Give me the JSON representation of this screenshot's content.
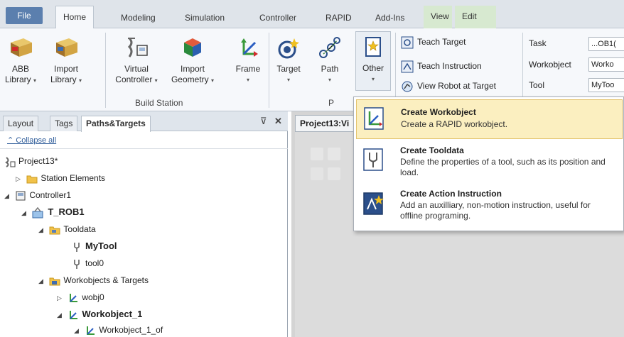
{
  "ribbon_tabs": [
    "File",
    "Home",
    "Modeling",
    "Simulation",
    "Controller",
    "RAPID",
    "Add-Ins",
    "View",
    "Edit"
  ],
  "ribbon": {
    "abb_library": {
      "line1": "ABB",
      "line2": "Library"
    },
    "import_library": {
      "line1": "Import",
      "line2": "Library"
    },
    "virtual_controller": {
      "line1": "Virtual",
      "line2": "Controller"
    },
    "import_geometry": {
      "line1": "Import",
      "line2": "Geometry"
    },
    "frame": "Frame",
    "target": "Target",
    "path": "Path",
    "other": "Other",
    "group_build_station": "Build Station",
    "group_path_programming_partial": "P",
    "teach_target": "Teach Target",
    "teach_instruction": "Teach Instruction",
    "view_robot_at_target": "View Robot at Target",
    "task_label": "Task",
    "task_value": "...OB1(",
    "workobject_label": "Workobject",
    "workobject_value": "Worko",
    "tool_label": "Tool",
    "tool_value": "MyToo"
  },
  "left_panel": {
    "tabs": [
      "Layout",
      "Tags",
      "Paths&Targets"
    ],
    "pin": "⊽",
    "close": "✕",
    "collapse_all": "Collapse all",
    "tree": {
      "project": "Project13*",
      "station_elements": "Station Elements",
      "controller": "Controller1",
      "task": "T_ROB1",
      "tooldata": "Tooldata",
      "mytool": "MyTool",
      "tool0": "tool0",
      "workobjects_targets": "Workobjects & Targets",
      "wobj0": "wobj0",
      "workobject1": "Workobject_1",
      "workobject1_of": "Workobject_1_of"
    }
  },
  "document": {
    "tab_title": "Project13:Vi"
  },
  "dropdown": {
    "items": [
      {
        "title": "Create Workobject",
        "desc": "Create a RAPID workobject."
      },
      {
        "title": "Create Tooldata",
        "desc": "Define the properties of a tool, such as its position and load."
      },
      {
        "title": "Create Action Instruction",
        "desc": "Add an auxilliary, non-motion instruction, useful for offline programing."
      }
    ]
  },
  "colors": {
    "ribbon_bg": "#f6f8fb",
    "file_tab": "#5b7fae",
    "highlight": "#fbefc0",
    "view_edit_tab": "#d7e9d0"
  }
}
